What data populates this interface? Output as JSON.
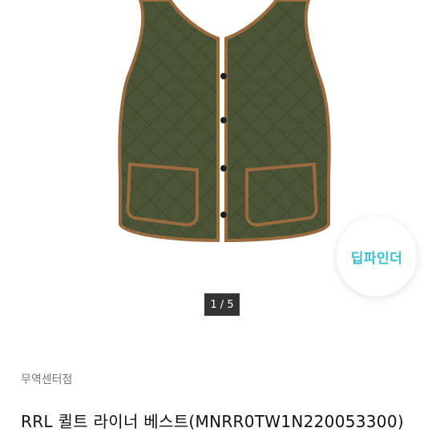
{
  "product": {
    "image_alt": "RRL quilted liner vest",
    "image_page_current": "1",
    "image_page_total": "5",
    "image_page_indicator": "1 / 5",
    "seller": "무역센터점",
    "title": "RRL 퀼트 라이너 베스트(MNRR0TW1N220053300)"
  },
  "badge": {
    "label": "딥파인더",
    "color": "#38c0cf"
  },
  "colors": {
    "vest": "#4a5236",
    "trim": "#9a6b3f",
    "indicator_bg": "#333333"
  }
}
